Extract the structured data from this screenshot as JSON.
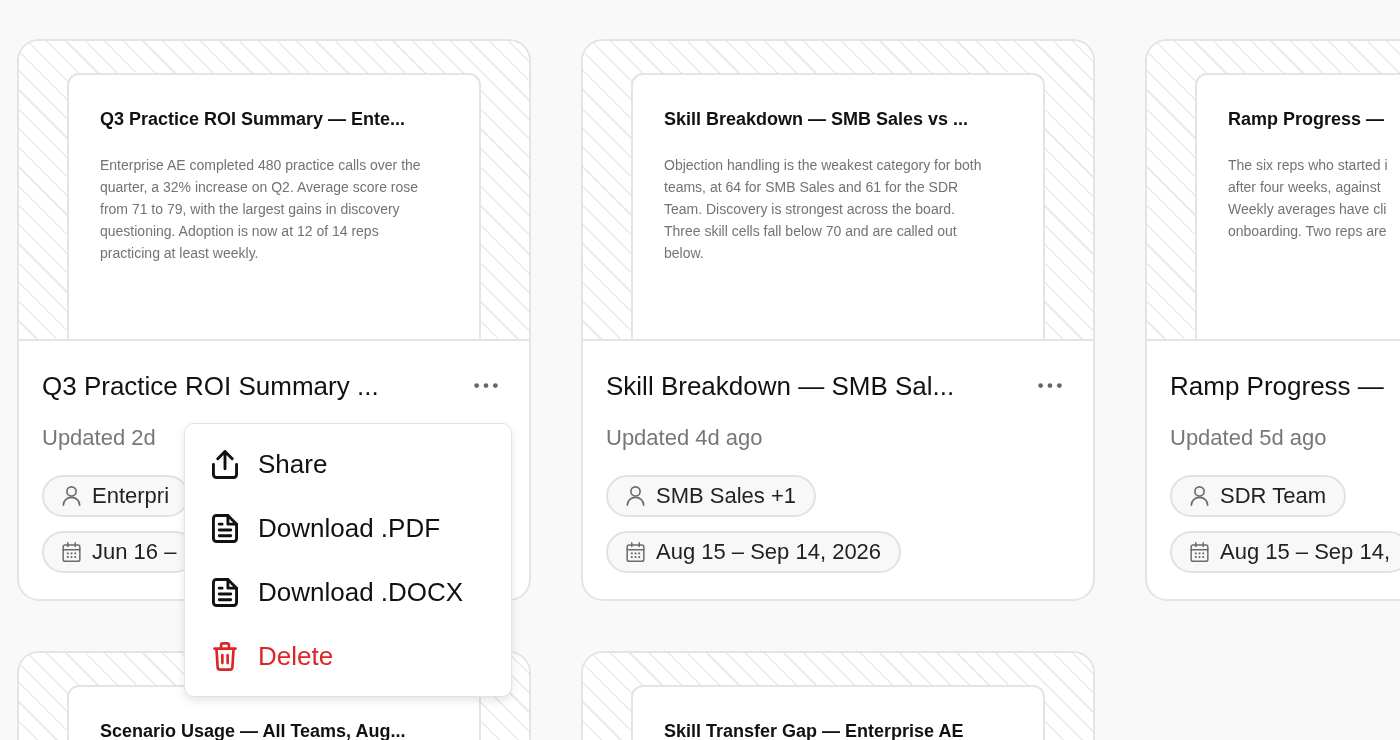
{
  "reports": [
    {
      "preview": {
        "title": "Q3 Practice ROI Summary — Ente...",
        "body_lines": [
          "Enterprise AE completed 480 practice calls over the",
          "quarter, a 32% increase on Q2. Average score rose",
          "from 71 to 79, with the largest gains in discovery",
          "questioning. Adoption is now at 12 of 14 reps",
          "practicing at least weekly."
        ]
      },
      "title": "Q3 Practice ROI Summary ...",
      "menu_button": true,
      "updated": "Updated 2d",
      "tags": [
        {
          "kind": "team",
          "label": "Enterpri"
        },
        {
          "kind": "date",
          "label": "Jun 16 –"
        }
      ],
      "menu": [
        {
          "kind": "share",
          "label": "Share"
        },
        {
          "kind": "download",
          "label": "Download .PDF"
        },
        {
          "kind": "download",
          "label": "Download .DOCX"
        },
        {
          "kind": "delete",
          "label": "Delete"
        }
      ]
    },
    {
      "preview": {
        "title": "Skill Breakdown — SMB Sales vs ...",
        "body_lines": [
          "Objection handling is the weakest category for both",
          "teams, at 64 for SMB Sales and 61 for the SDR",
          "Team. Discovery is strongest across the board.",
          "Three skill cells fall below 70 and are called out",
          "below."
        ]
      },
      "title": "Skill Breakdown — SMB Sal...",
      "menu_button": true,
      "updated": "Updated 4d ago",
      "tags": [
        {
          "kind": "team",
          "label": "SMB Sales +1"
        },
        {
          "kind": "date",
          "label": "Aug 15 – Sep 14, 2026"
        }
      ]
    },
    {
      "preview": {
        "title": "Ramp Progress —",
        "body_lines": [
          "The six reps who started i",
          "after four weeks, against",
          "Weekly averages have cli",
          "onboarding. Two reps are"
        ]
      },
      "title": "Ramp Progress —",
      "menu_button": false,
      "updated": "Updated 5d ago",
      "tags": [
        {
          "kind": "team",
          "label": "SDR Team"
        },
        {
          "kind": "date",
          "label": "Aug 15 – Sep 14,"
        }
      ]
    },
    {
      "preview": {
        "title": "Scenario Usage — All Teams, Aug..."
      }
    },
    {
      "preview": {
        "title": "Skill Transfer Gap — Enterprise AE"
      }
    }
  ]
}
